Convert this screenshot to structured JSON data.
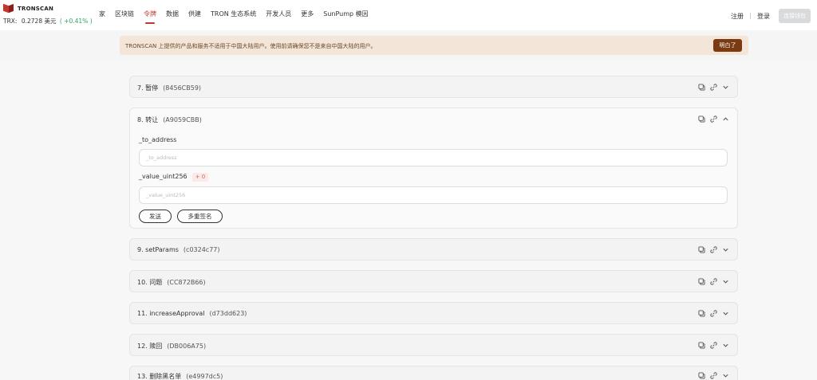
{
  "brand": {
    "name": "TRONSCAN"
  },
  "ticker": {
    "label": "TRX:",
    "price": "0.2728 美元",
    "change": "( +0.41% )"
  },
  "nav": {
    "items": [
      "家",
      "区块链",
      "令牌",
      "数据",
      "供建",
      "TRON 生态系统",
      "开发人员",
      "更多",
      "SunPump 模因"
    ],
    "active_index": 2
  },
  "account": {
    "register": "注册",
    "login": "登录",
    "connect_wallet": "连接钱包"
  },
  "notice": {
    "text": "TRONSCAN 上提供的产品和服务不适用于中国大陆用户。使用前请确保您不是来自中国大陆的用户。",
    "button": "明白了"
  },
  "functions": [
    {
      "index": "7. 暂停",
      "sig": "(8456CB59)",
      "expanded": false
    },
    {
      "index": "8. 转让",
      "sig": "(A9059CBB)",
      "expanded": true
    },
    {
      "index": "9. setParams",
      "sig": "(c0324c77)",
      "expanded": false
    },
    {
      "index": "10. 问题",
      "sig": "(CC872B66)",
      "expanded": false
    },
    {
      "index": "11. increaseApproval",
      "sig": "(d73dd623)",
      "expanded": false
    },
    {
      "index": "12. 赎回",
      "sig": "(DB006A75)",
      "expanded": false
    },
    {
      "index": "13. 删除黑名单",
      "sig": "(e4997dc5)",
      "expanded": false
    }
  ],
  "transfer_form": {
    "to_address_label": "_to_address",
    "to_address_placeholder": "_to_address",
    "value_label": "_value_uint256",
    "value_tag": "+ 0",
    "value_placeholder": "_value_uint256",
    "send_button": "发送",
    "multisig_button": "多重签名"
  },
  "icons": {
    "copy": "copy-icon",
    "link": "link-icon",
    "expand": "chevron-down-icon",
    "collapse": "chevron-up-icon"
  },
  "colors": {
    "accent": "#c23631",
    "notice_bg": "#f3e5d8",
    "notice_button": "#7a3b12",
    "positive": "#2aa764"
  }
}
